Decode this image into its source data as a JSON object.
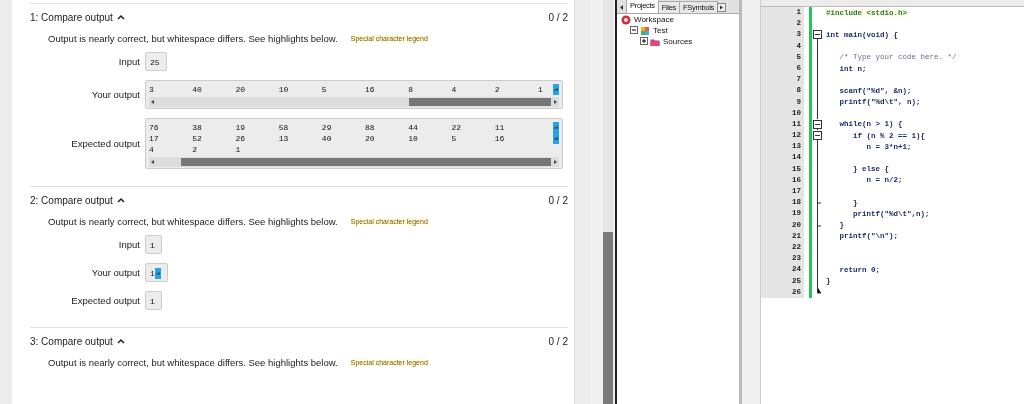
{
  "tests": [
    {
      "title": "1: Compare output",
      "expanded": true,
      "score": "0 / 2",
      "message": "Output is nearly correct, but whitespace differs. See highlights below.",
      "legend": "Special character legend",
      "fields": [
        {
          "label": "Input",
          "kind": "inline",
          "lines": [
            {
              "text": "25",
              "marker": false
            }
          ]
        },
        {
          "label": "Your output",
          "kind": "wide",
          "lines": [
            {
              "text": "3\t40\t20\t10\t5\t16\t8\t4\t2\t1",
              "marker": true
            }
          ]
        },
        {
          "label": "Expected output",
          "kind": "wide",
          "lines": [
            {
              "text": "76\t38\t19\t58\t29\t88\t44\t22\t11",
              "marker": true
            },
            {
              "text": "17\t52\t26\t13\t40\t20\t10\t5\t16",
              "marker": true
            },
            {
              "text": "4\t2\t1",
              "marker": false
            }
          ]
        }
      ]
    },
    {
      "title": "2: Compare output",
      "expanded": true,
      "score": "0 / 2",
      "message": "Output is nearly correct, but whitespace differs. See highlights below.",
      "legend": "Special character legend",
      "fields": [
        {
          "label": "Input",
          "kind": "inline",
          "lines": [
            {
              "text": "1",
              "marker": false
            }
          ]
        },
        {
          "label": "Your output",
          "kind": "inline",
          "lines": [
            {
              "text": "1",
              "marker": true
            }
          ]
        },
        {
          "label": "Expected output",
          "kind": "inline",
          "lines": [
            {
              "text": "1",
              "marker": false
            }
          ]
        }
      ]
    },
    {
      "title": "3: Compare output",
      "expanded": true,
      "score": "0 / 2",
      "message": "Output is nearly correct, but whitespace differs. See highlights below.",
      "legend": "Special character legend"
    }
  ],
  "panel": {
    "tabs": [
      {
        "label": "Projects",
        "selected": true
      },
      {
        "label": "Files",
        "selected": false
      },
      {
        "label": "FSymbols",
        "selected": false
      }
    ],
    "tree": [
      {
        "label": "Workspace",
        "kind": "workspace",
        "children": [
          {
            "label": "Test",
            "kind": "project",
            "expanded": true,
            "children": [
              {
                "label": "Sources",
                "kind": "folder",
                "expanded": false
              }
            ]
          }
        ]
      }
    ]
  },
  "editor": {
    "lines": [
      {
        "number": "1",
        "text": "#include <stdio.h>",
        "kind": "preprocessor"
      },
      {
        "number": "2"
      },
      {
        "number": "3",
        "text": "int main(void) {",
        "fold_start": true
      },
      {
        "number": "4"
      },
      {
        "number": "5",
        "text": "   /* Type your code here. */",
        "kind": "comment"
      },
      {
        "number": "6",
        "text": "   int n;"
      },
      {
        "number": "7"
      },
      {
        "number": "8",
        "text": "   scanf(\"%d\", &n);"
      },
      {
        "number": "9",
        "text": "   printf(\"%d\\t\", n);"
      },
      {
        "number": "10"
      },
      {
        "number": "11",
        "text": "   while(n > 1) {",
        "fold_start": true
      },
      {
        "number": "12",
        "text": "      if (n % 2 == 1){",
        "fold_start": true
      },
      {
        "number": "13",
        "text": "         n = 3*n+1;"
      },
      {
        "number": "14"
      },
      {
        "number": "15",
        "text": "      } else {"
      },
      {
        "number": "16",
        "text": "         n = n/2;"
      },
      {
        "number": "17"
      },
      {
        "number": "18",
        "text": "      }",
        "fold_end": true
      },
      {
        "number": "19",
        "text": "      printf(\"%d\\t\",n);"
      },
      {
        "number": "20",
        "text": "   }",
        "fold_end": true
      },
      {
        "number": "21",
        "text": "   printf(\"\\n\");"
      },
      {
        "number": "22"
      },
      {
        "number": "23"
      },
      {
        "number": "24",
        "text": "   return 0;"
      },
      {
        "number": "25",
        "text": "}"
      },
      {
        "number": "26",
        "fold_end": true
      }
    ]
  }
}
